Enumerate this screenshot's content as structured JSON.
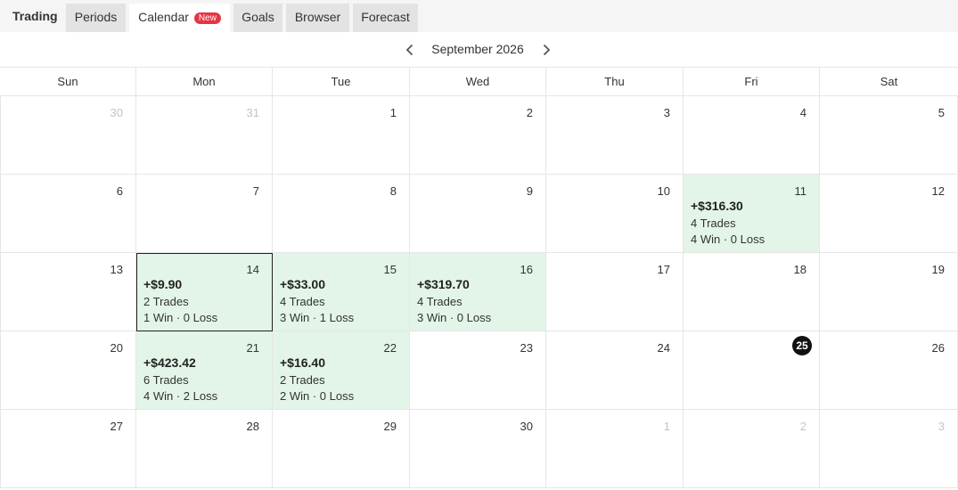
{
  "app": {
    "brand": "Trading"
  },
  "tabs": [
    {
      "label": "Periods",
      "active": false
    },
    {
      "label": "Calendar",
      "active": true,
      "badge": "New"
    },
    {
      "label": "Goals",
      "active": false
    },
    {
      "label": "Browser",
      "active": false
    },
    {
      "label": "Forecast",
      "active": false
    }
  ],
  "calendar": {
    "month_label": "September 2026",
    "prev_icon": "chevron-left-icon",
    "next_icon": "chevron-right-icon",
    "weekdays": [
      "Sun",
      "Mon",
      "Tue",
      "Wed",
      "Thu",
      "Fri",
      "Sat"
    ],
    "today": "25",
    "profit_color": "#e2f5e8",
    "weeks": [
      [
        {
          "day": "30",
          "muted": true
        },
        {
          "day": "31",
          "muted": true
        },
        {
          "day": "1"
        },
        {
          "day": "2"
        },
        {
          "day": "3"
        },
        {
          "day": "4"
        },
        {
          "day": "5"
        }
      ],
      [
        {
          "day": "6"
        },
        {
          "day": "7"
        },
        {
          "day": "8"
        },
        {
          "day": "9"
        },
        {
          "day": "10"
        },
        {
          "day": "11",
          "pnl": "+$316.30",
          "trades": "4 Trades",
          "winloss": "4 Win · 0 Loss"
        },
        {
          "day": "12"
        }
      ],
      [
        {
          "day": "13"
        },
        {
          "day": "14",
          "pnl": "+$9.90",
          "trades": "2 Trades",
          "winloss": "1 Win · 0 Loss",
          "selected": true
        },
        {
          "day": "15",
          "pnl": "+$33.00",
          "trades": "4 Trades",
          "winloss": "3 Win · 1 Loss"
        },
        {
          "day": "16",
          "pnl": "+$319.70",
          "trades": "4 Trades",
          "winloss": "3 Win · 0 Loss"
        },
        {
          "day": "17"
        },
        {
          "day": "18"
        },
        {
          "day": "19"
        }
      ],
      [
        {
          "day": "20"
        },
        {
          "day": "21",
          "pnl": "+$423.42",
          "trades": "6 Trades",
          "winloss": "4 Win · 2 Loss"
        },
        {
          "day": "22",
          "pnl": "+$16.40",
          "trades": "2 Trades",
          "winloss": "2 Win · 0 Loss"
        },
        {
          "day": "23"
        },
        {
          "day": "24"
        },
        {
          "day": "25",
          "today": true
        },
        {
          "day": "26"
        }
      ],
      [
        {
          "day": "27"
        },
        {
          "day": "28"
        },
        {
          "day": "29"
        },
        {
          "day": "30"
        },
        {
          "day": "1",
          "muted": true
        },
        {
          "day": "2",
          "muted": true
        },
        {
          "day": "3",
          "muted": true
        }
      ]
    ]
  }
}
